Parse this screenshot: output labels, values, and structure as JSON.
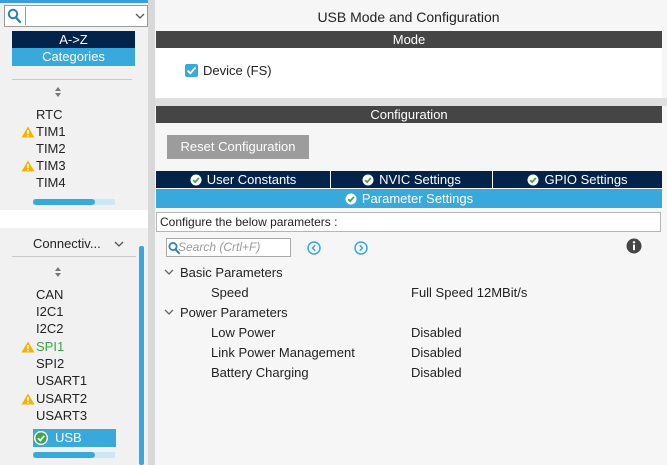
{
  "sidebar": {
    "search_value": "",
    "sort_az_label": "A->Z",
    "categories_label": "Categories",
    "timers_items": [
      {
        "label": "RTC",
        "state": "normal"
      },
      {
        "label": "TIM1",
        "state": "warning"
      },
      {
        "label": "TIM2",
        "state": "normal"
      },
      {
        "label": "TIM3",
        "state": "warning"
      },
      {
        "label": "TIM4",
        "state": "normal"
      }
    ],
    "connectivity_label": "Connectiv...",
    "connectivity_items": [
      {
        "label": "CAN",
        "state": "normal"
      },
      {
        "label": "I2C1",
        "state": "normal"
      },
      {
        "label": "I2C2",
        "state": "normal"
      },
      {
        "label": "SPI1",
        "state": "warning-green"
      },
      {
        "label": "SPI2",
        "state": "normal"
      },
      {
        "label": "USART1",
        "state": "normal"
      },
      {
        "label": "USART2",
        "state": "warning"
      },
      {
        "label": "USART3",
        "state": "normal"
      },
      {
        "label": "USB",
        "state": "selected"
      }
    ]
  },
  "main": {
    "title": "USB Mode and Configuration",
    "mode_header": "Mode",
    "device_fs_label": "Device (FS)",
    "device_fs_checked": true,
    "configuration_header": "Configuration",
    "reset_button_label": "Reset Configuration",
    "tabs": [
      {
        "label": "User Constants"
      },
      {
        "label": "NVIC Settings"
      },
      {
        "label": "GPIO Settings"
      }
    ],
    "active_tab": {
      "label": "Parameter Settings"
    },
    "configure_text": "Configure the below parameters :",
    "search_placeholder": "Search (Crtl+F)",
    "groups": [
      {
        "label": "Basic Parameters",
        "params": [
          {
            "name": "Speed",
            "value": "Full Speed 12MBit/s"
          }
        ]
      },
      {
        "label": "Power Parameters",
        "params": [
          {
            "name": "Low Power",
            "value": "Disabled"
          },
          {
            "name": "Link Power Management",
            "value": "Disabled"
          },
          {
            "name": "Battery Charging",
            "value": "Disabled"
          }
        ]
      }
    ]
  },
  "colors": {
    "accent_blue": "#39a9dc",
    "dark_navy": "#03234b",
    "header_dark": "#454545",
    "warning_yellow": "#f3b300",
    "ok_green": "#3aa645"
  },
  "icons": [
    "search-icon",
    "chevron-down-icon",
    "sort-icon",
    "warning-icon",
    "check-circle-icon",
    "left-arrow-circle-icon",
    "right-arrow-circle-icon",
    "info-icon",
    "chevron-group-icon"
  ]
}
